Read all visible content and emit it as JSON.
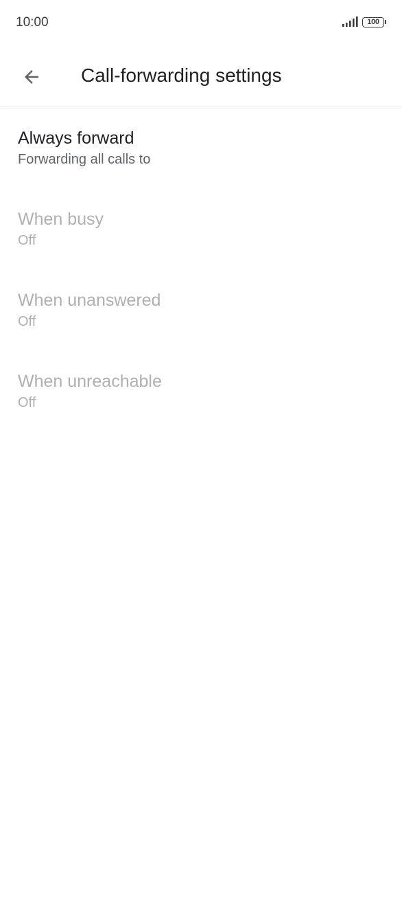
{
  "status_bar": {
    "time": "10:00",
    "battery_level": "100",
    "icons": [
      "signal-icon",
      "battery-icon"
    ]
  },
  "app_bar": {
    "back_icon": "arrow-back-icon",
    "title": "Call-forwarding settings"
  },
  "settings": [
    {
      "title": "Always forward",
      "summary": "Forwarding all calls to",
      "enabled": true
    },
    {
      "title": "When busy",
      "summary": "Off",
      "enabled": false
    },
    {
      "title": "When unanswered",
      "summary": "Off",
      "enabled": false
    },
    {
      "title": "When unreachable",
      "summary": "Off",
      "enabled": false
    }
  ],
  "colors": {
    "primary_text": "#202124",
    "secondary_text": "#5f6368",
    "disabled_text": "#b0b0b0",
    "background": "#ffffff"
  }
}
